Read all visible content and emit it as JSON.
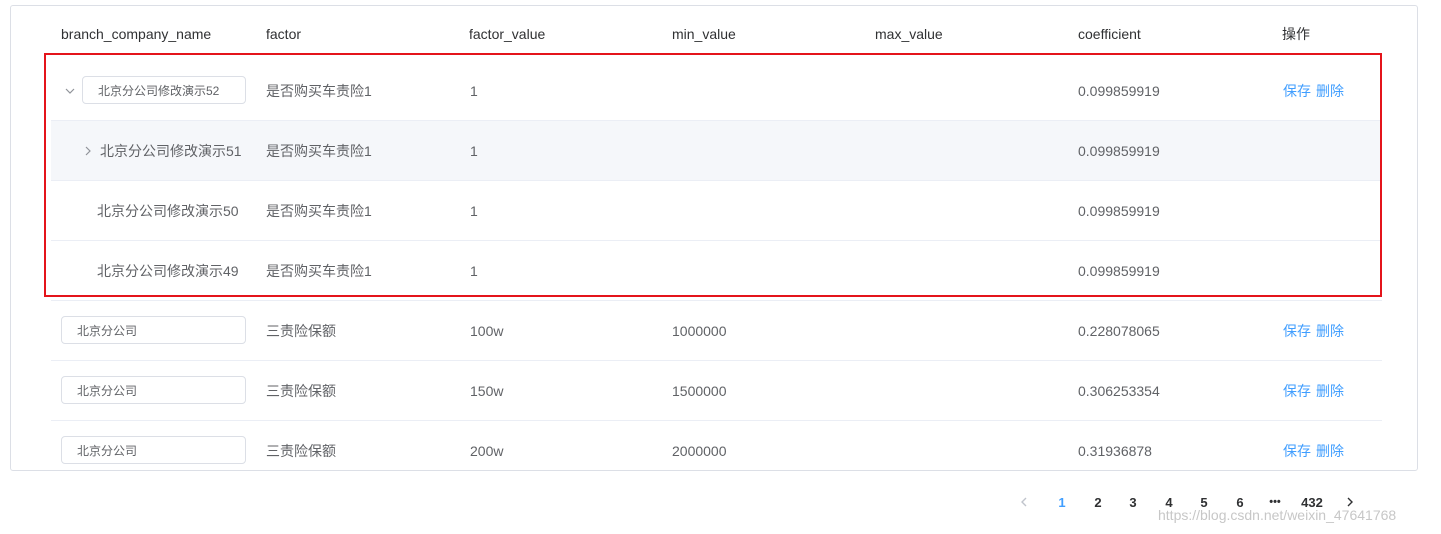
{
  "table": {
    "columns": [
      "branch_company_name",
      "factor",
      "factor_value",
      "min_value",
      "max_value",
      "coefficient",
      "操作"
    ],
    "rows": [
      {
        "branch": "北京分公司修改演示52",
        "factor": "是否购买车责险1",
        "factor_value": "1",
        "min_value": "",
        "max_value": "",
        "coefficient": "0.099859919",
        "save": "保存",
        "delete": "删除"
      },
      {
        "branch": "北京分公司修改演示51",
        "factor": "是否购买车责险1",
        "factor_value": "1",
        "min_value": "",
        "max_value": "",
        "coefficient": "0.099859919"
      },
      {
        "branch": "北京分公司修改演示50",
        "factor": "是否购买车责险1",
        "factor_value": "1",
        "min_value": "",
        "max_value": "",
        "coefficient": "0.099859919"
      },
      {
        "branch": "北京分公司修改演示49",
        "factor": "是否购买车责险1",
        "factor_value": "1",
        "min_value": "",
        "max_value": "",
        "coefficient": "0.099859919"
      },
      {
        "branch": "北京分公司",
        "factor": "三责险保额",
        "factor_value": "100w",
        "min_value": "1000000",
        "max_value": "",
        "coefficient": "0.228078065",
        "save": "保存",
        "delete": "删除"
      },
      {
        "branch": "北京分公司",
        "factor": "三责险保额",
        "factor_value": "150w",
        "min_value": "1500000",
        "max_value": "",
        "coefficient": "0.306253354",
        "save": "保存",
        "delete": "删除"
      },
      {
        "branch": "北京分公司",
        "factor": "三责险保额",
        "factor_value": "200w",
        "min_value": "2000000",
        "max_value": "",
        "coefficient": "0.31936878",
        "save": "保存",
        "delete": "删除"
      }
    ]
  },
  "pagination": {
    "pages": [
      "1",
      "2",
      "3",
      "4",
      "5",
      "6"
    ],
    "ellipsis": "•••",
    "last": "432",
    "current": "1"
  },
  "watermark": "https://blog.csdn.net/weixin_47641768",
  "colors": {
    "accent": "#409eff",
    "highlight": "#e4141b",
    "border": "#ebeef5"
  }
}
